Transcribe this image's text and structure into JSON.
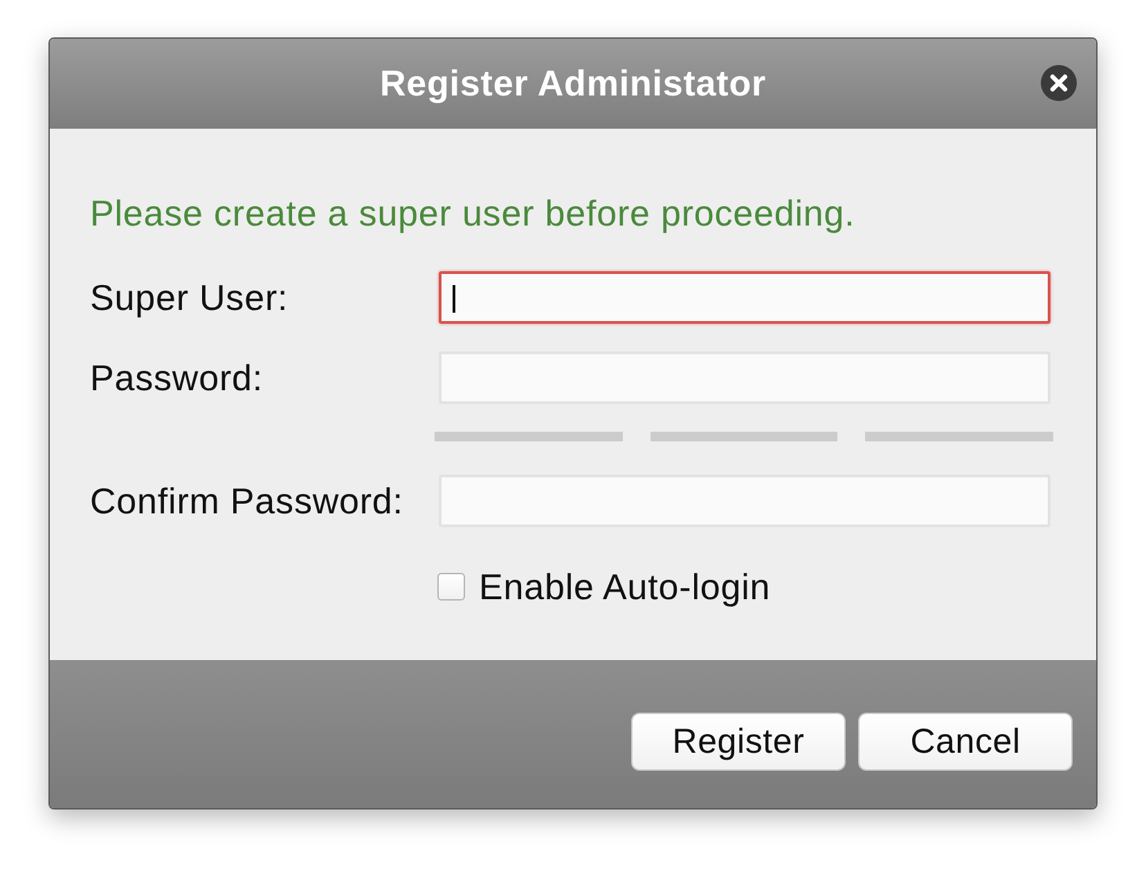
{
  "window": {
    "title": "Register Administator"
  },
  "message": "Please create a super user before proceeding.",
  "fields": [
    {
      "label": "Super User:",
      "focused": true,
      "invalid": true
    },
    {
      "label": "Password:",
      "focused": false,
      "invalid": false,
      "strength_meter": {
        "segments": [
          {
            "lit": false
          },
          {
            "lit": false
          },
          {
            "lit": false
          }
        ]
      }
    },
    {
      "label": "Confirm Password:",
      "focused": false,
      "invalid": false
    }
  ],
  "checkbox": {
    "label": "Enable Auto-login",
    "checked": false
  },
  "buttons": [
    {
      "label": "Register"
    },
    {
      "label": "Cancel"
    }
  ]
}
